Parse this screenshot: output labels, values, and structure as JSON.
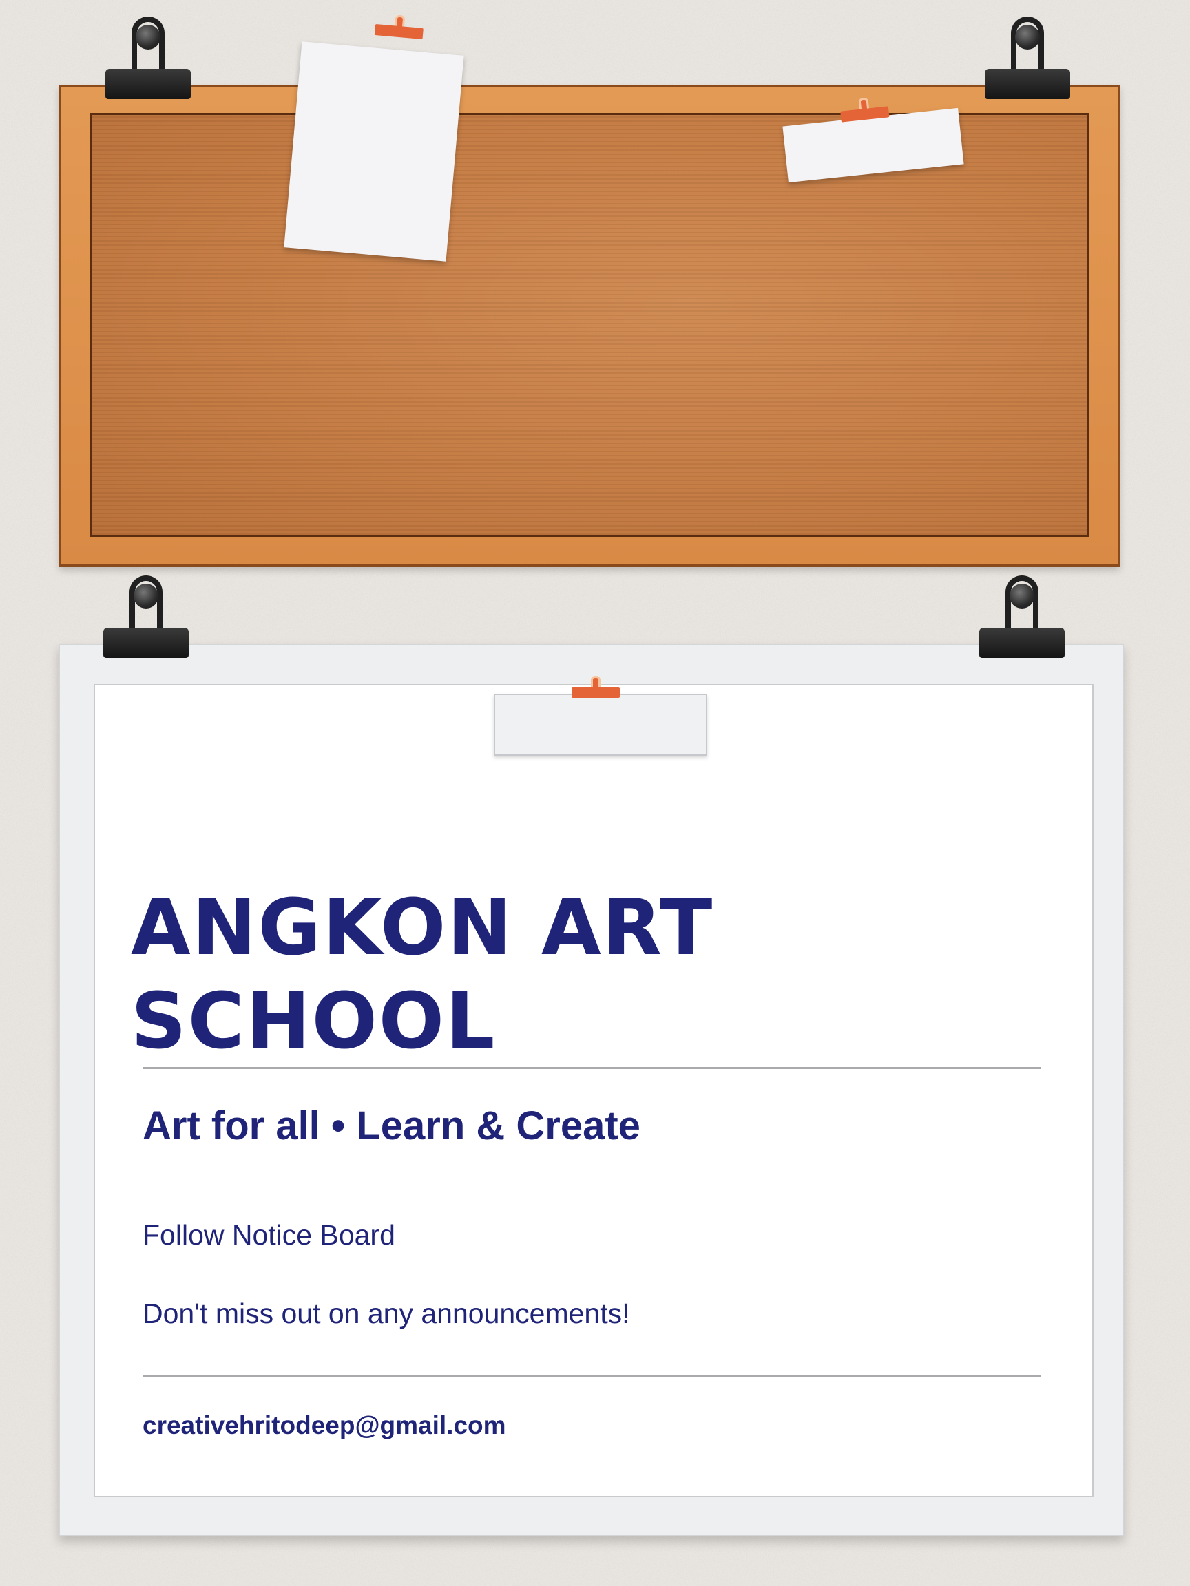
{
  "colors": {
    "wall": "#ebe7e2",
    "cork": "#c57b43",
    "frame_wood": "#d98a45",
    "text_navy": "#1f2478",
    "paper": "#ffffff",
    "pin_orange": "#e46438",
    "clip_black": "#1a1a1a"
  },
  "notice_board": {
    "title": "ANGKON ART SCHOOL",
    "tagline": "Art for all • Learn & Create",
    "lines": [
      "Follow Notice Board",
      "Don't miss out on any announcements!"
    ],
    "email": "creativehritodeep@gmail.com"
  }
}
